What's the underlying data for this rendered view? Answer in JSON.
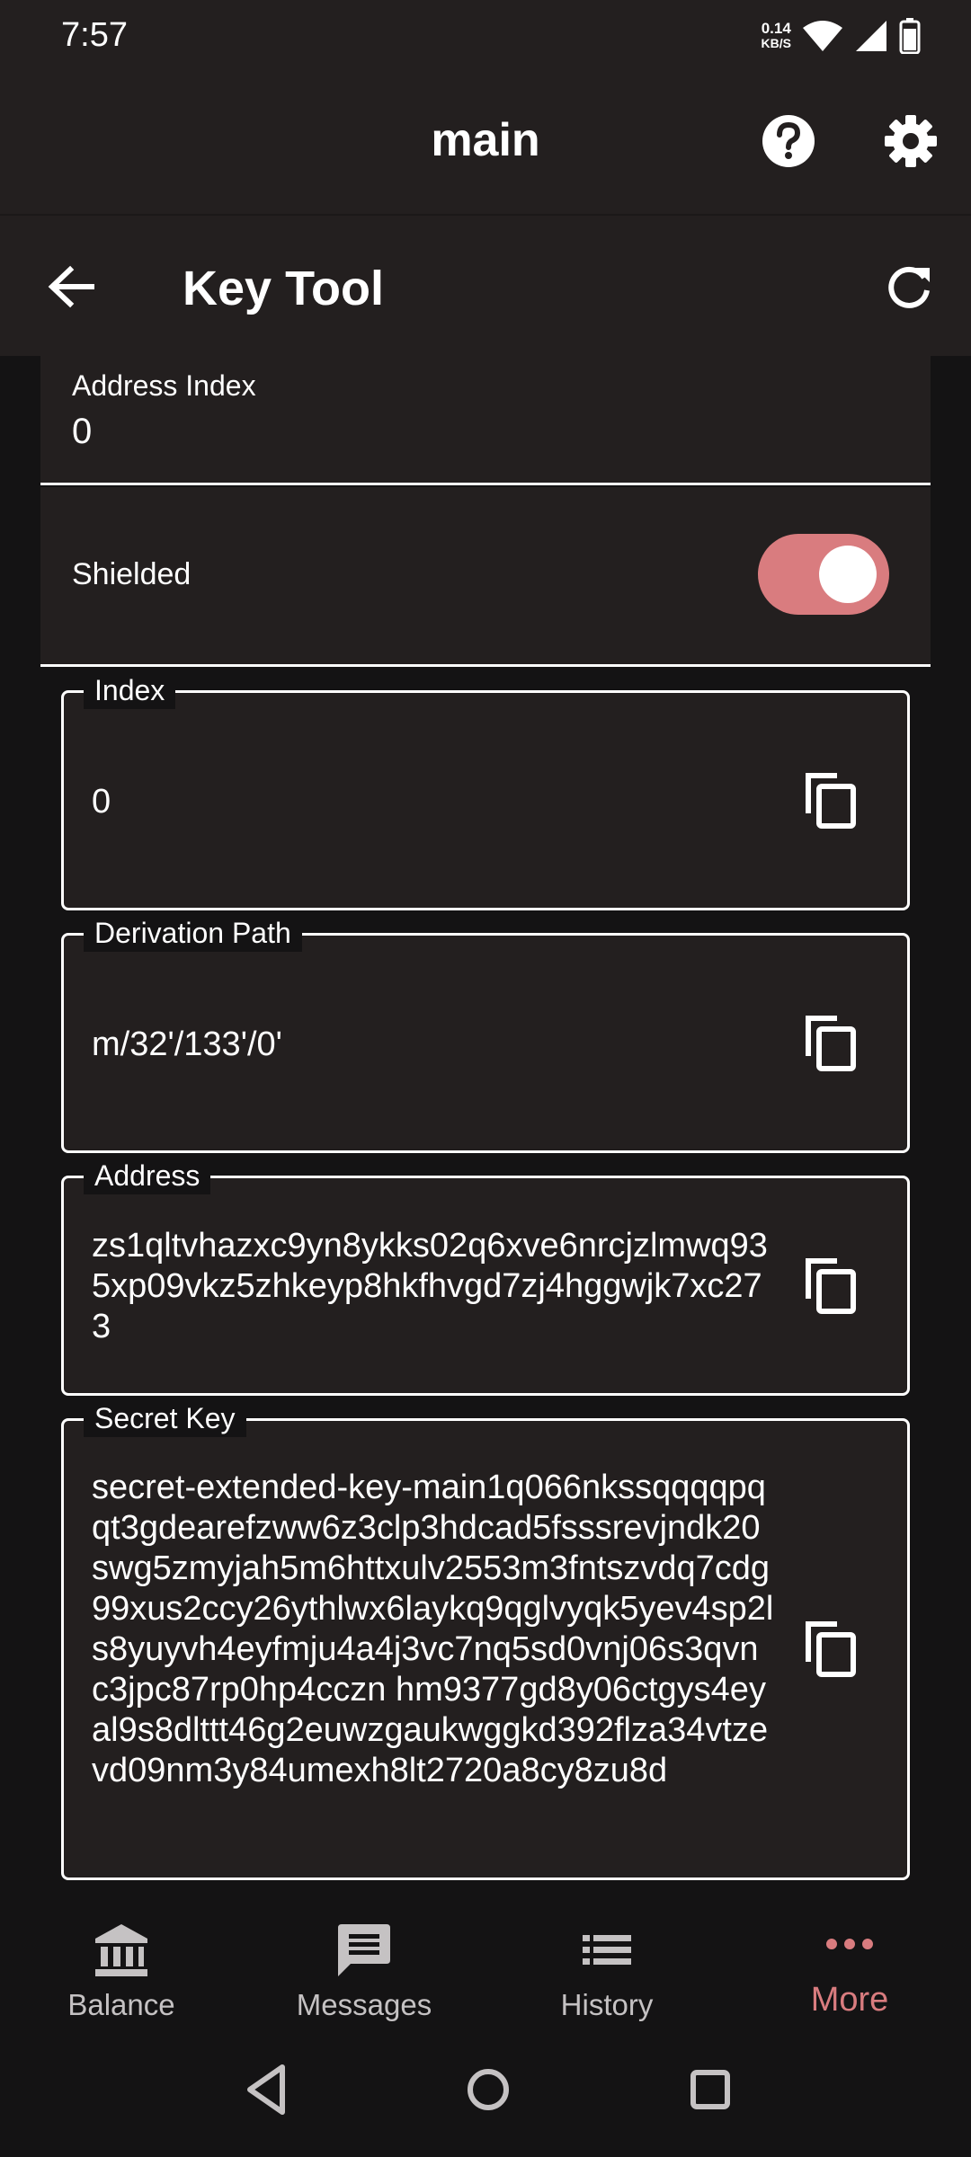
{
  "status_bar": {
    "time": "7:57",
    "net_speed_value": "0.14",
    "net_speed_unit": "KB/S"
  },
  "app_bar": {
    "title": "main"
  },
  "sub_bar": {
    "title": "Key Tool"
  },
  "address_index": {
    "label": "Address Index",
    "value": "0"
  },
  "shielded": {
    "label": "Shielded",
    "enabled": true
  },
  "fields": {
    "index": {
      "label": "Index",
      "value": "0"
    },
    "derivation_path": {
      "label": "Derivation Path",
      "value": "m/32'/133'/0'"
    },
    "address": {
      "label": "Address",
      "value": "zs1qltvhazxc9yn8ykks02q6xve6nrcjzlmwq935xp09vkz5zhkeyp8hkfhvgd7zj4hggwjk7xc273"
    },
    "secret_key": {
      "label": "Secret Key",
      "value": "secret-extended-key-main1q066nkssqqqqpqqt3gdearefzww6z3clp3hdcad5fsssrevjndk20swg5zmyjah5m6httxulv2553m3fntszvdq7cdg99xus2ccy26ythlwx6laykq9qglvyqk5yev4sp2ls8yuyvh4eyfmju4a4j3vc7nq5sd0vnj06s3qvnc3jpc87rp0hp4cczn hm9377gd8y06ctgys4eyal9s8dlttt46g2euwzgaukwggkd392flza34vtzevd09nm3y84umexh8lt2720a8cy8zu8d"
    }
  },
  "bottom_nav": {
    "balance": "Balance",
    "messages": "Messages",
    "history": "History",
    "more": "More"
  },
  "colors": {
    "accent": "#d97c7f",
    "bar_background": "#231f1f",
    "page_background": "#141314"
  }
}
